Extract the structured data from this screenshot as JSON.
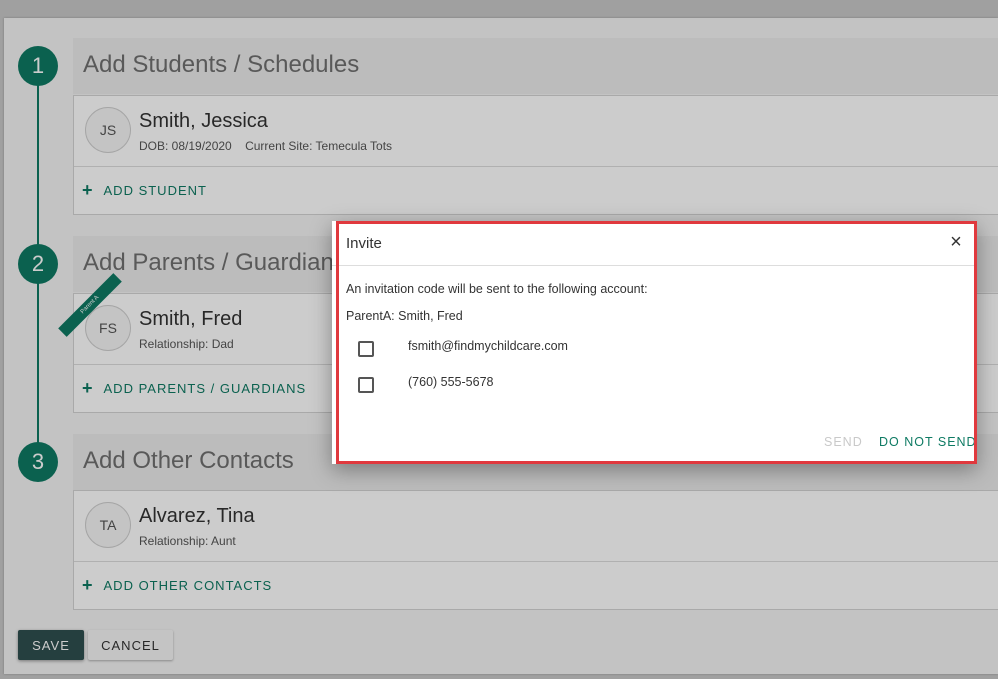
{
  "steps": [
    {
      "number": "1",
      "title": "Add Students / Schedules"
    },
    {
      "number": "2",
      "title": "Add Parents / Guardians"
    },
    {
      "number": "3",
      "title": "Add Other Contacts"
    }
  ],
  "students": [
    {
      "initials": "JS",
      "name": "Smith, Jessica",
      "dob": "DOB: 08/19/2020",
      "site": "Current Site: Temecula Tots"
    }
  ],
  "add_student_label": "ADD STUDENT",
  "parents": [
    {
      "initials": "FS",
      "name": "Smith, Fred",
      "relationship": "Relationship: Dad",
      "ribbon": "Parent A"
    }
  ],
  "add_parents_label": "ADD PARENTS / GUARDIANS",
  "contacts": [
    {
      "initials": "TA",
      "name": "Alvarez, Tina",
      "relationship": "Relationship: Aunt"
    }
  ],
  "add_contacts_label": "ADD OTHER CONTACTS",
  "buttons": {
    "save": "SAVE",
    "cancel": "CANCEL"
  },
  "dialog": {
    "title": "Invite",
    "close_icon": "×",
    "message": "An invitation code will be sent to the following account:",
    "account": "ParentA: Smith, Fred",
    "options": [
      {
        "label": "fsmith@findmychildcare.com",
        "checked": false
      },
      {
        "label": "(760) 555-5678",
        "checked": false
      }
    ],
    "send_label": "SEND",
    "do_not_send_label": "DO NOT SEND"
  },
  "colors": {
    "accent": "#0e7a63",
    "highlight": "#e0393e",
    "save_button": "#2f4f4f"
  }
}
